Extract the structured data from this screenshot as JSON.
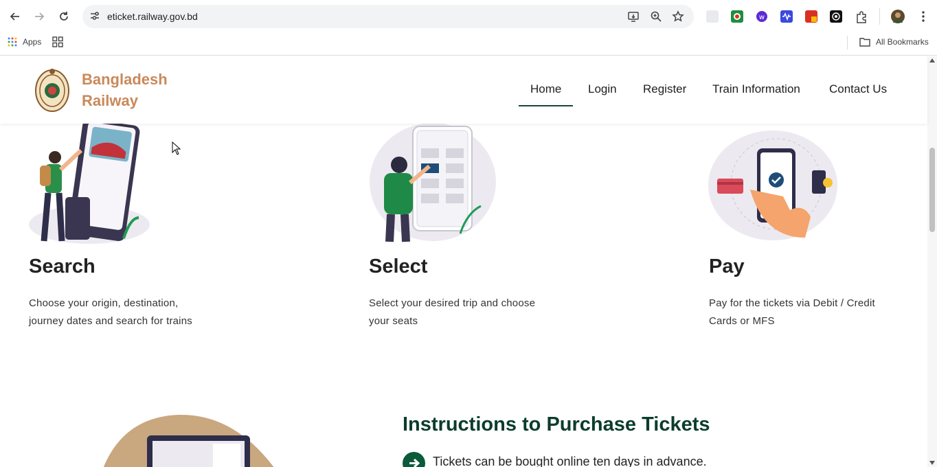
{
  "browser": {
    "url": "eticket.railway.gov.bd",
    "bookmarks": {
      "apps_label": "Apps",
      "all_bookmarks_label": "All Bookmarks"
    }
  },
  "site": {
    "brand_line1": "Bangladesh",
    "brand_line2": "Railway",
    "menu": {
      "home": "Home",
      "login": "Login",
      "register": "Register",
      "train_information": "Train Information",
      "contact_us": "Contact Us"
    },
    "active_menu": "Home"
  },
  "steps": [
    {
      "title": "Search",
      "desc": "Choose your origin, destination, journey dates and search for trains"
    },
    {
      "title": "Select",
      "desc": "Select your desired trip and choose your seats"
    },
    {
      "title": "Pay",
      "desc": "Pay for the tickets via Debit / Credit Cards or MFS"
    }
  ],
  "instructions": {
    "title": "Instructions to Purchase Tickets",
    "first_item": "Tickets can be bought online ten days in advance."
  },
  "colors": {
    "brand": "#c9895a",
    "accent_green": "#0b3d2b",
    "active_underline": "#1b4438"
  }
}
